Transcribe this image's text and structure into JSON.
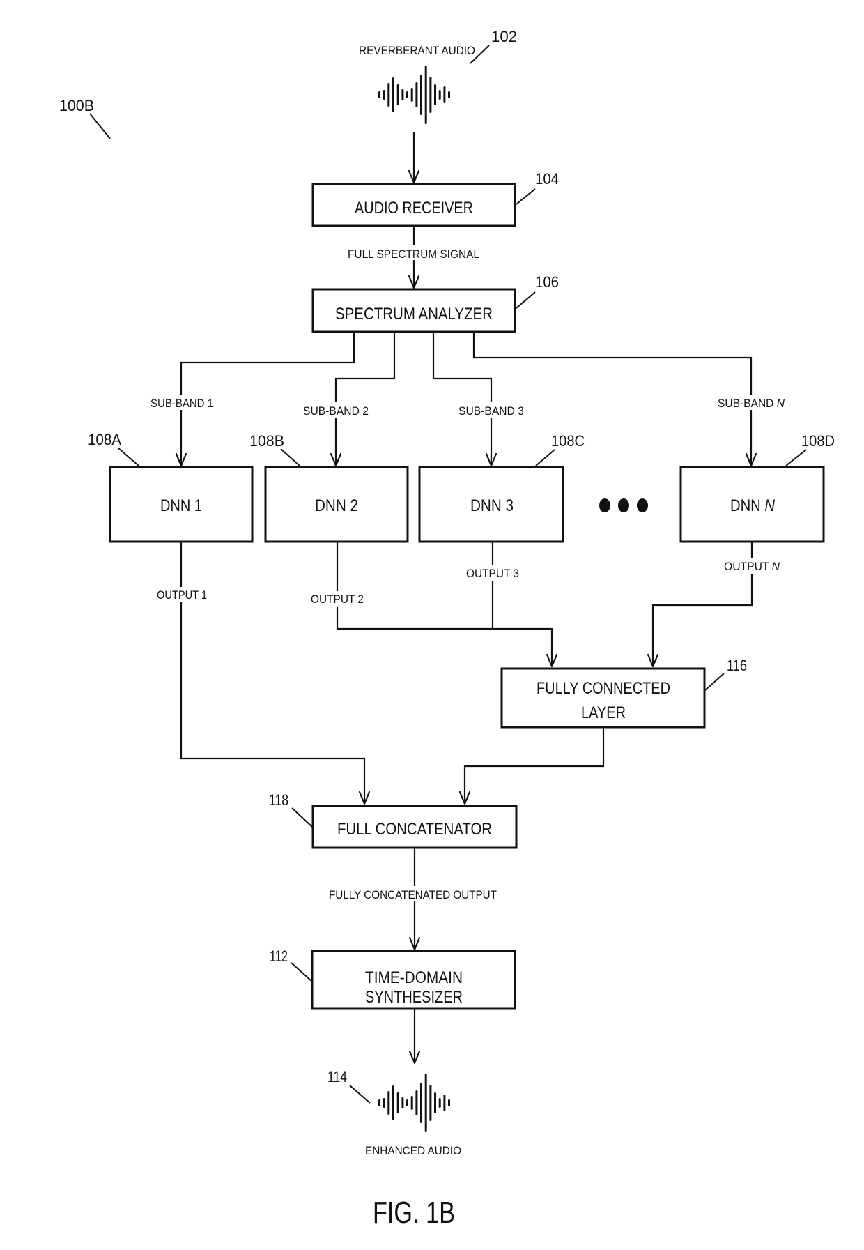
{
  "figure": {
    "id_label": "100B",
    "caption": "FIG. 1B"
  },
  "input_audio": {
    "label": "REVERBERANT AUDIO",
    "ref": "102",
    "icon": "waveform-icon"
  },
  "audio_receiver": {
    "label": "AUDIO RECEIVER",
    "ref": "104"
  },
  "full_spectrum_signal": {
    "label": "FULL SPECTRUM SIGNAL"
  },
  "spectrum_analyzer": {
    "label": "SPECTRUM ANALYZER",
    "ref": "106"
  },
  "sub_bands": [
    {
      "prefix": "SUB-BAND ",
      "index": "1"
    },
    {
      "prefix": "SUB-BAND ",
      "index": "2"
    },
    {
      "prefix": "SUB-BAND ",
      "index": "3"
    },
    {
      "prefix": "SUB-BAND ",
      "index": "N"
    }
  ],
  "dnns": [
    {
      "prefix": "DNN ",
      "index": "1",
      "ref": "108A"
    },
    {
      "prefix": "DNN ",
      "index": "2",
      "ref": "108B"
    },
    {
      "prefix": "DNN ",
      "index": "3",
      "ref": "108C"
    },
    {
      "prefix": "DNN ",
      "index": "N",
      "ref": "108D"
    }
  ],
  "ellipsis": "more-dnns-ellipsis",
  "outputs": [
    {
      "prefix": "OUTPUT ",
      "index": "1"
    },
    {
      "prefix": "OUTPUT ",
      "index": "2"
    },
    {
      "prefix": "OUTPUT ",
      "index": "3"
    },
    {
      "prefix": "OUTPUT ",
      "index": "N"
    }
  ],
  "fully_connected_layer": {
    "label_line1": "FULLY CONNECTED",
    "label_line2": "LAYER",
    "ref": "116"
  },
  "full_concatenator": {
    "label": "FULL CONCATENATOR",
    "ref": "118"
  },
  "fully_concatenated_output": {
    "label": "FULLY CONCATENATED OUTPUT"
  },
  "time_domain_synthesizer": {
    "label_line1": "TIME-DOMAIN",
    "label_line2": "SYNTHESIZER",
    "ref": "112"
  },
  "output_audio": {
    "label": "ENHANCED AUDIO",
    "ref": "114",
    "icon": "waveform-icon"
  }
}
